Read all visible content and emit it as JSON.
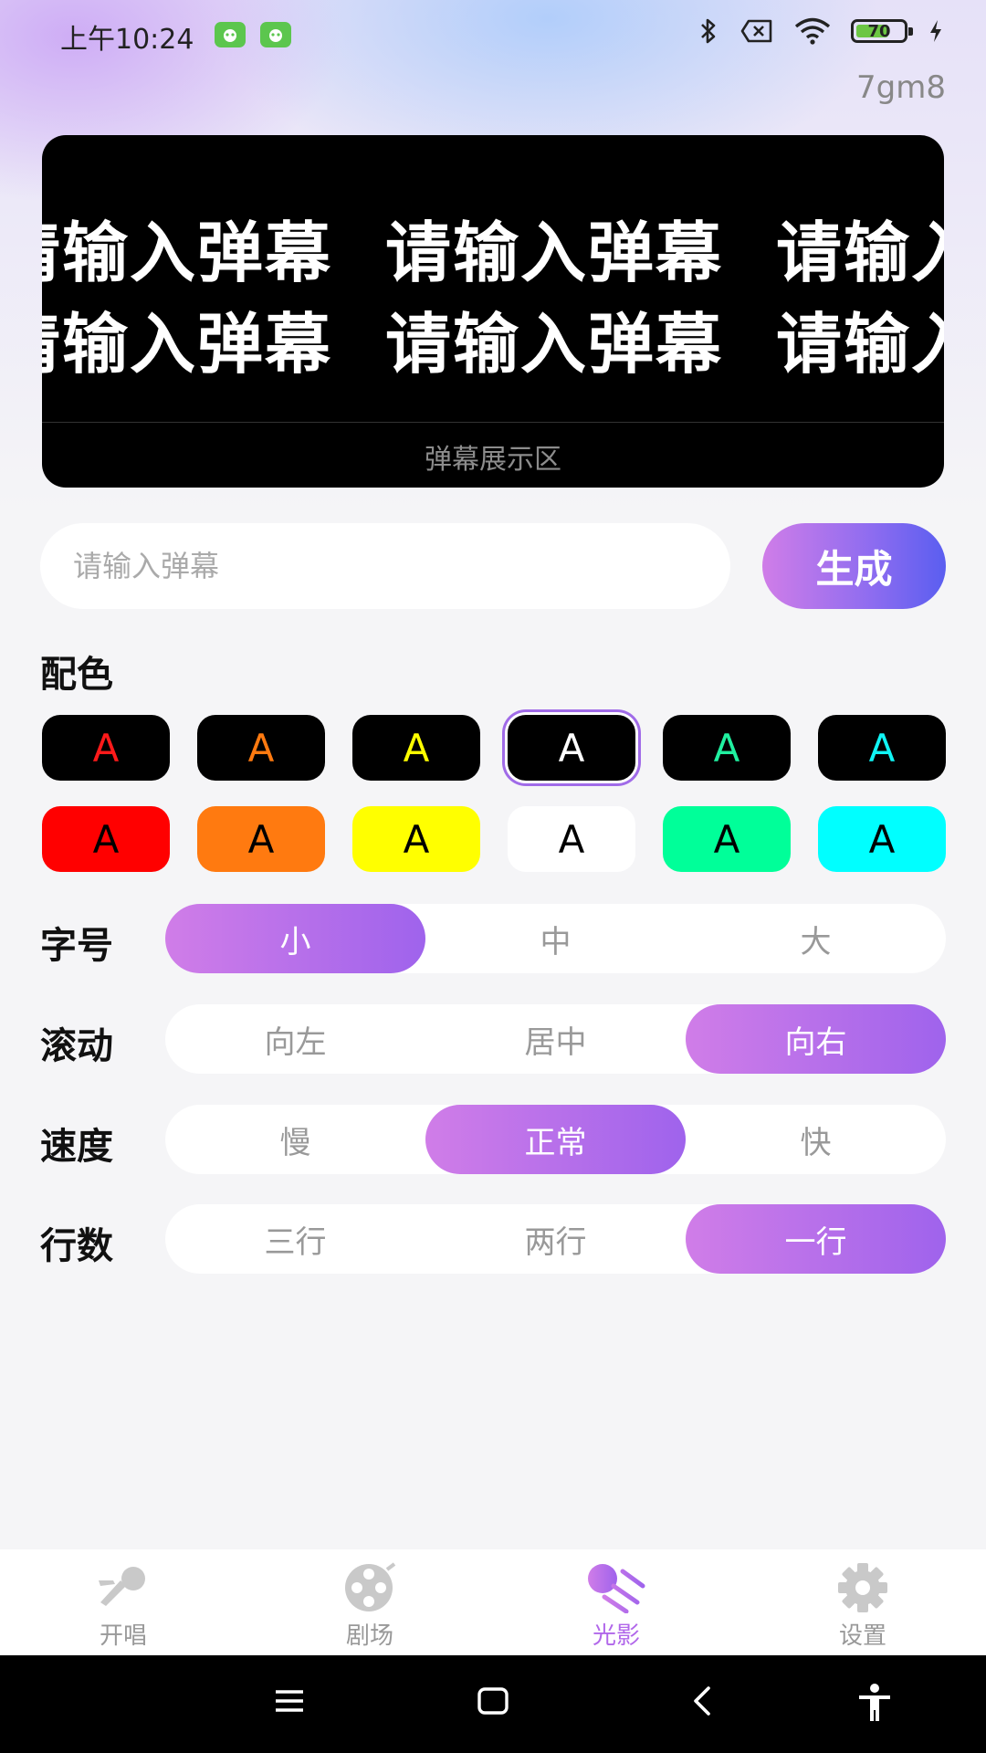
{
  "status_bar": {
    "time": "上午10:24",
    "battery": "70",
    "battery_level": 0.7
  },
  "header": {
    "code": "7gm8"
  },
  "display": {
    "scroll_text": "请输入弹幕",
    "caption": "弹幕展示区"
  },
  "input": {
    "placeholder": "请输入弹幕",
    "value": ""
  },
  "generate_button": "生成",
  "colors": {
    "label": "配色",
    "swatch_text": "A",
    "row1": [
      {
        "bg": "#000000",
        "fg": "#ff1a1a"
      },
      {
        "bg": "#000000",
        "fg": "#ff7a10"
      },
      {
        "bg": "#000000",
        "fg": "#ffff00"
      },
      {
        "bg": "#000000",
        "fg": "#ffffff",
        "selected": true
      },
      {
        "bg": "#000000",
        "fg": "#20f0a0"
      },
      {
        "bg": "#000000",
        "fg": "#10f5f5"
      }
    ],
    "row2": [
      {
        "bg": "#ff0000",
        "fg": "#000000"
      },
      {
        "bg": "#ff7a10",
        "fg": "#000000"
      },
      {
        "bg": "#ffff00",
        "fg": "#000000"
      },
      {
        "bg": "#ffffff",
        "fg": "#000000"
      },
      {
        "bg": "#00ff99",
        "fg": "#000000"
      },
      {
        "bg": "#00ffff",
        "fg": "#000000"
      }
    ]
  },
  "font_size": {
    "label": "字号",
    "options": [
      "小",
      "中",
      "大"
    ],
    "selected": 0
  },
  "scroll": {
    "label": "滚动",
    "options": [
      "向左",
      "居中",
      "向右"
    ],
    "selected": 2
  },
  "speed": {
    "label": "速度",
    "options": [
      "慢",
      "正常",
      "快"
    ],
    "selected": 1
  },
  "lines": {
    "label": "行数",
    "options": [
      "三行",
      "两行",
      "一行"
    ],
    "selected": 2
  },
  "tabs": [
    {
      "label": "开唱",
      "icon": "microphone-icon"
    },
    {
      "label": "剧场",
      "icon": "film-reel-icon"
    },
    {
      "label": "光影",
      "icon": "light-beam-icon",
      "active": true
    },
    {
      "label": "设置",
      "icon": "gear-icon"
    }
  ],
  "theme": {
    "accent": "#b167ea",
    "gradient_start": "#d07de8",
    "gradient_end": "#5a5ef0"
  }
}
